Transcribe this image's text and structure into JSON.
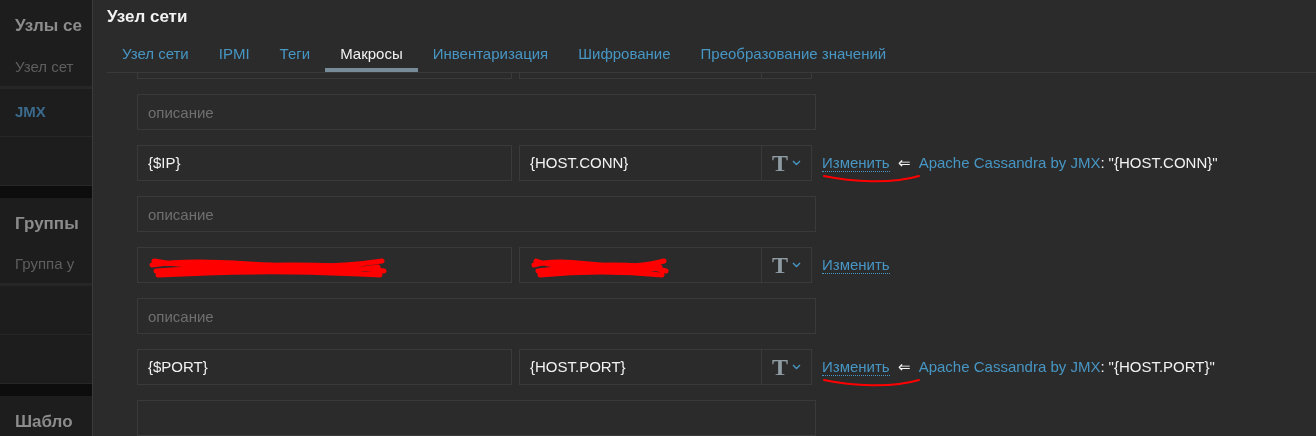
{
  "background_page": {
    "sections": [
      {
        "title": "Узлы се",
        "rows": [
          {
            "text": "Узел сет",
            "kind": "label"
          },
          {
            "text": "JMX",
            "kind": "link"
          },
          {
            "kind": "empty"
          }
        ]
      },
      {
        "title": "Группы",
        "rows": [
          {
            "text": "Группа у",
            "kind": "label"
          },
          {
            "kind": "empty"
          },
          {
            "kind": "empty"
          }
        ]
      },
      {
        "title": "Шабло"
      }
    ]
  },
  "dialog": {
    "title": "Узел сети",
    "tabs": [
      {
        "label": "Узел сети",
        "selected": false
      },
      {
        "label": "IPMI",
        "selected": false
      },
      {
        "label": "Теги",
        "selected": false
      },
      {
        "label": "Макросы",
        "selected": true
      },
      {
        "label": "Инвентаризация",
        "selected": false
      },
      {
        "label": "Шифрование",
        "selected": false
      },
      {
        "label": "Преобразование значений",
        "selected": false
      }
    ],
    "macros": [
      {
        "kind": "cut"
      },
      {
        "kind": "description",
        "placeholder": "описание"
      },
      {
        "kind": "macro",
        "macro": "{$IP}",
        "value": "{HOST.CONN}",
        "type_icon": "T",
        "redacted": false,
        "action": "Изменить",
        "annotated": true,
        "inherited": {
          "arrow": "⇐",
          "template": "Apache Cassandra by JMX",
          "separator": ":",
          "value": "\"{HOST.CONN}\""
        }
      },
      {
        "kind": "description",
        "placeholder": "описание"
      },
      {
        "kind": "macro",
        "type_icon": "T",
        "redacted": true,
        "action": "Изменить",
        "annotated": false
      },
      {
        "kind": "description",
        "placeholder": "описание"
      },
      {
        "kind": "macro",
        "macro": "{$PORT}",
        "value": "{HOST.PORT}",
        "type_icon": "T",
        "redacted": false,
        "action": "Изменить",
        "annotated": true,
        "inherited": {
          "arrow": "⇐",
          "template": "Apache Cassandra by JMX",
          "separator": ":",
          "value": "\"{HOST.PORT}\""
        }
      },
      {
        "kind": "description_cut"
      }
    ]
  }
}
